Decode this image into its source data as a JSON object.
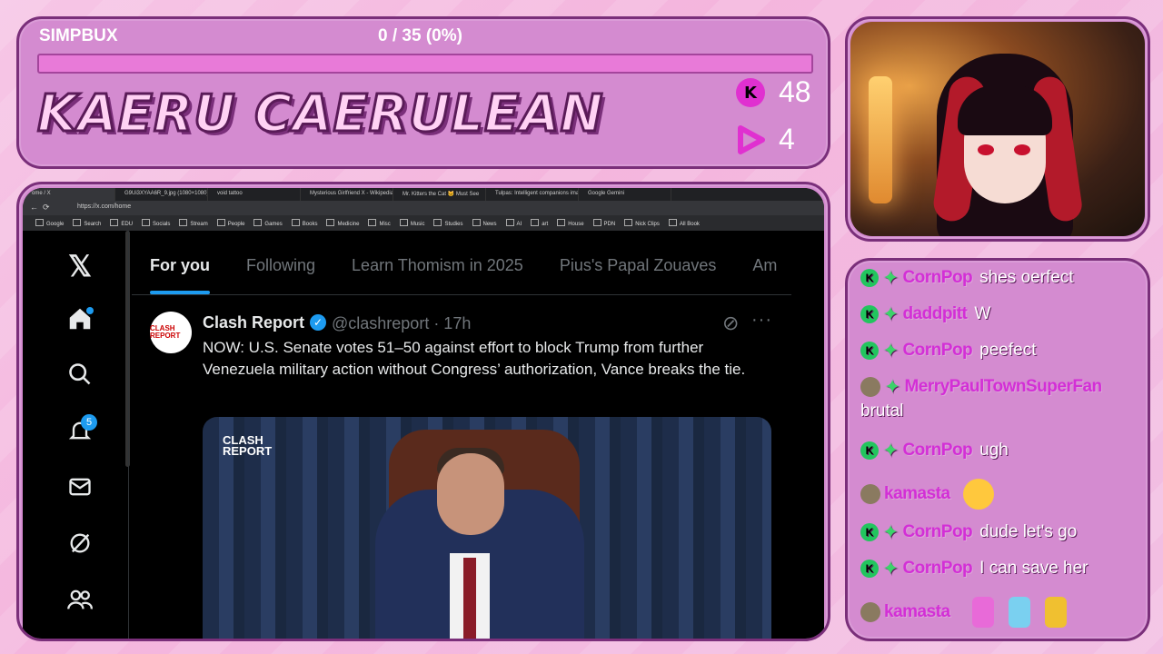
{
  "overlay": {
    "goal_label": "SIMPBUX",
    "goal_count": "0 / 35 (0%)",
    "goal_progress": 0,
    "streamer_name": "KAERU CAERULEAN",
    "kick_count": "48",
    "live_count": "4",
    "accent": "#d48bd0"
  },
  "browser": {
    "tabs": [
      "ome / X",
      "G9Ui3XYAA6R_9.jpg (1080×1080)",
      "void tattoo",
      "Mysterious Girlfriend X - Wikipedia",
      "Mr. Kitters the Cat 🐱 Must See",
      "Tulpas: Intelligent companions ima",
      "Google Gemini"
    ],
    "url": "https://x.com/home",
    "bookmarks": [
      "Google",
      "Search",
      "EDU",
      "Socials",
      "Stream",
      "People",
      "Games",
      "Books",
      "Medicine",
      "Misc",
      "Music",
      "Studies",
      "News",
      "AI",
      "art",
      "House",
      "PDN",
      "Nick Clips",
      "All Book"
    ]
  },
  "x": {
    "nav_icons": [
      "x-logo-icon",
      "home-icon",
      "search-icon",
      "notifications-icon",
      "messages-icon",
      "grok-icon",
      "communities-icon"
    ],
    "notification_count": "5",
    "feed_tabs": [
      "For you",
      "Following",
      "Learn Thomism in 2025",
      "Pius's Papal Zouaves",
      "Am"
    ],
    "post": {
      "avatar_text": "CLASH REPORT",
      "name": "Clash Report",
      "handle": "@clashreport · 17h",
      "text": "NOW: U.S. Senate votes 51–50 against effort to block Trump from further Venezuela military action without Congress’ authorization, Vance breaks the tie.",
      "media_logo": "CLASH REPORT"
    }
  },
  "chat": [
    {
      "user": "CornPop",
      "text": "shes oerfect"
    },
    {
      "user": "daddpitt",
      "text": "W"
    },
    {
      "user": "CornPop",
      "text": "peefect"
    },
    {
      "user": "MerryPaulTownSuperFan",
      "text": "brutal"
    },
    {
      "user": "CornPop",
      "text": "ugh"
    },
    {
      "user": "kamasta",
      "text": ""
    },
    {
      "user": "CornPop",
      "text": "dude let's go"
    },
    {
      "user": "CornPop",
      "text": "I can save her"
    },
    {
      "user": "kamasta",
      "text": ""
    }
  ]
}
